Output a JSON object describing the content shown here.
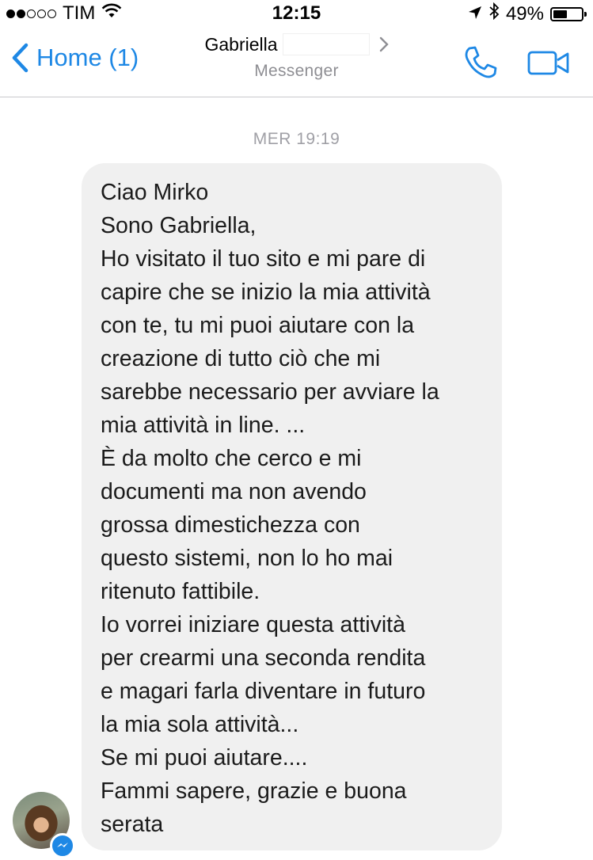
{
  "status_bar": {
    "carrier": "TIM",
    "signal_bars_filled": 2,
    "signal_bars_total": 5,
    "time": "12:15",
    "battery_percent_label": "49%",
    "battery_level": 0.49,
    "icons": [
      "wifi-icon",
      "location-arrow-icon",
      "bluetooth-icon",
      "battery-icon"
    ]
  },
  "nav": {
    "back_label": "Home (1)",
    "contact_name": "Gabriella",
    "subtitle": "Messenger",
    "accent_color": "#1e88e5",
    "icons": [
      "chevron-left-icon",
      "chevron-right-icon",
      "phone-icon",
      "video-camera-icon"
    ]
  },
  "conversation": {
    "timestamp": "MER 19:19",
    "message_lines": [
      "Ciao Mirko",
      "Sono Gabriella,",
      "Ho visitato il tuo sito e mi pare di",
      "capire che se inizio la mia attività",
      "con te, tu mi puoi aiutare con la",
      "creazione di tutto ciò che mi",
      "sarebbe necessario per avviare la",
      "mia attività in line. ...",
      "È da molto che cerco e mi",
      "documenti ma non avendo",
      "grossa dimestichezza con",
      "questo sistemi, non lo ho mai",
      "ritenuto fattibile.",
      "Io vorrei iniziare questa attività",
      "per crearmi una seconda rendita",
      "e magari farla diventare in futuro",
      "la mia sola attività...",
      "Se mi puoi aiutare....",
      "Fammi sapere, grazie e buona",
      "serata"
    ],
    "bubble_color": "#f0f0f0"
  }
}
